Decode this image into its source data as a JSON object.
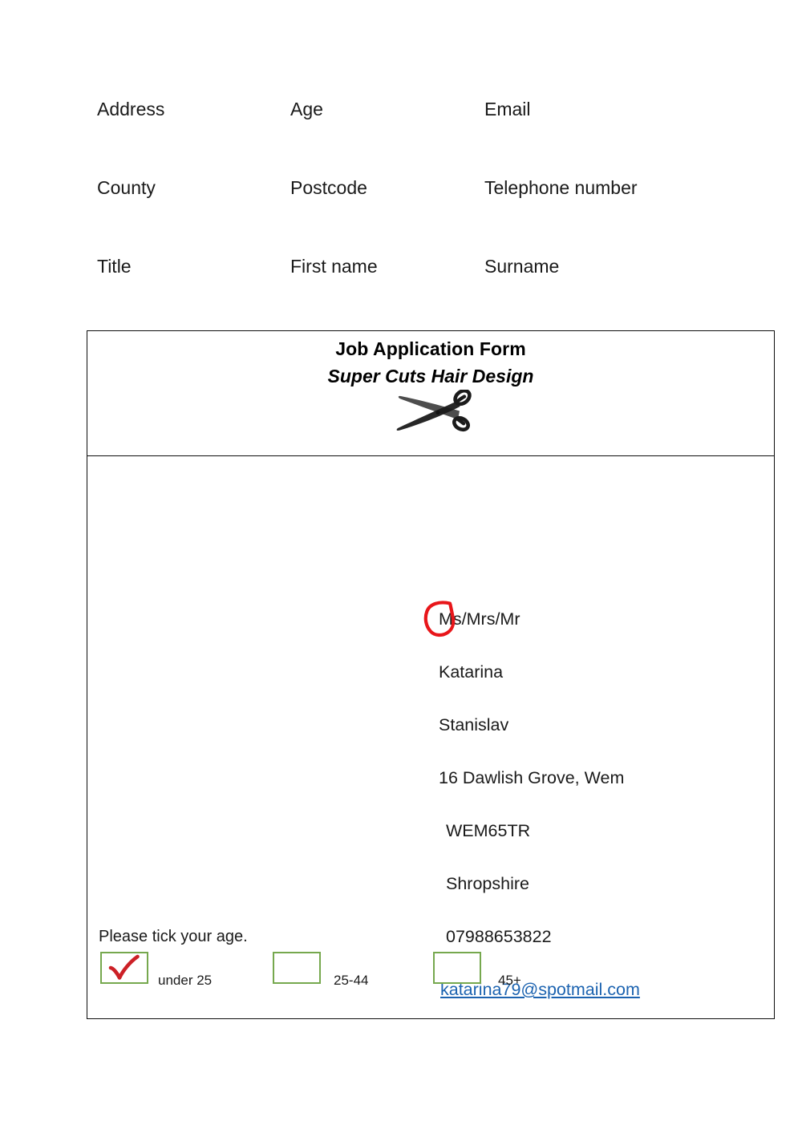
{
  "field_labels": [
    {
      "row": 1,
      "col": 1,
      "text": "Address"
    },
    {
      "row": 1,
      "col": 2,
      "text": "Age"
    },
    {
      "row": 1,
      "col": 3,
      "text": "Email"
    },
    {
      "row": 2,
      "col": 1,
      "text": "County"
    },
    {
      "row": 2,
      "col": 2,
      "text": "Postcode"
    },
    {
      "row": 2,
      "col": 3,
      "text": "Telephone number"
    },
    {
      "row": 3,
      "col": 1,
      "text": "Title"
    },
    {
      "row": 3,
      "col": 2,
      "text": "First name"
    },
    {
      "row": 3,
      "col": 3,
      "text": "Surname"
    }
  ],
  "form": {
    "title": "Job Application Form",
    "subtitle": "Super Cuts Hair Design",
    "logo_icon": "scissors-icon",
    "answers": [
      {
        "name": "title",
        "value": "Ms/Mrs/Mr",
        "annotation": "red-circle-around-Ms"
      },
      {
        "name": "first-name",
        "value": "Katarina"
      },
      {
        "name": "surname",
        "value": "Stanislav"
      },
      {
        "name": "address",
        "value": "16 Dawlish Grove, Wem"
      },
      {
        "name": "postcode",
        "value": "WEM65TR"
      },
      {
        "name": "county",
        "value": "Shropshire"
      },
      {
        "name": "telephone",
        "value": "07988653822"
      },
      {
        "name": "email",
        "value": "katarina79@spotmail.com",
        "is_link": true
      }
    ],
    "age_section": {
      "prompt": "Please tick your age.",
      "options": [
        {
          "label": "under 25",
          "checked": true
        },
        {
          "label": "25-44",
          "checked": false
        },
        {
          "label": "45+",
          "checked": false
        }
      ]
    }
  },
  "colors": {
    "checkbox_border": "#76a84e",
    "tick_mark": "#cc2026",
    "annotation_circle": "#e8161a",
    "link": "#1c63b0",
    "table_border": "#0d0d0d",
    "text": "#1a1a1a"
  }
}
